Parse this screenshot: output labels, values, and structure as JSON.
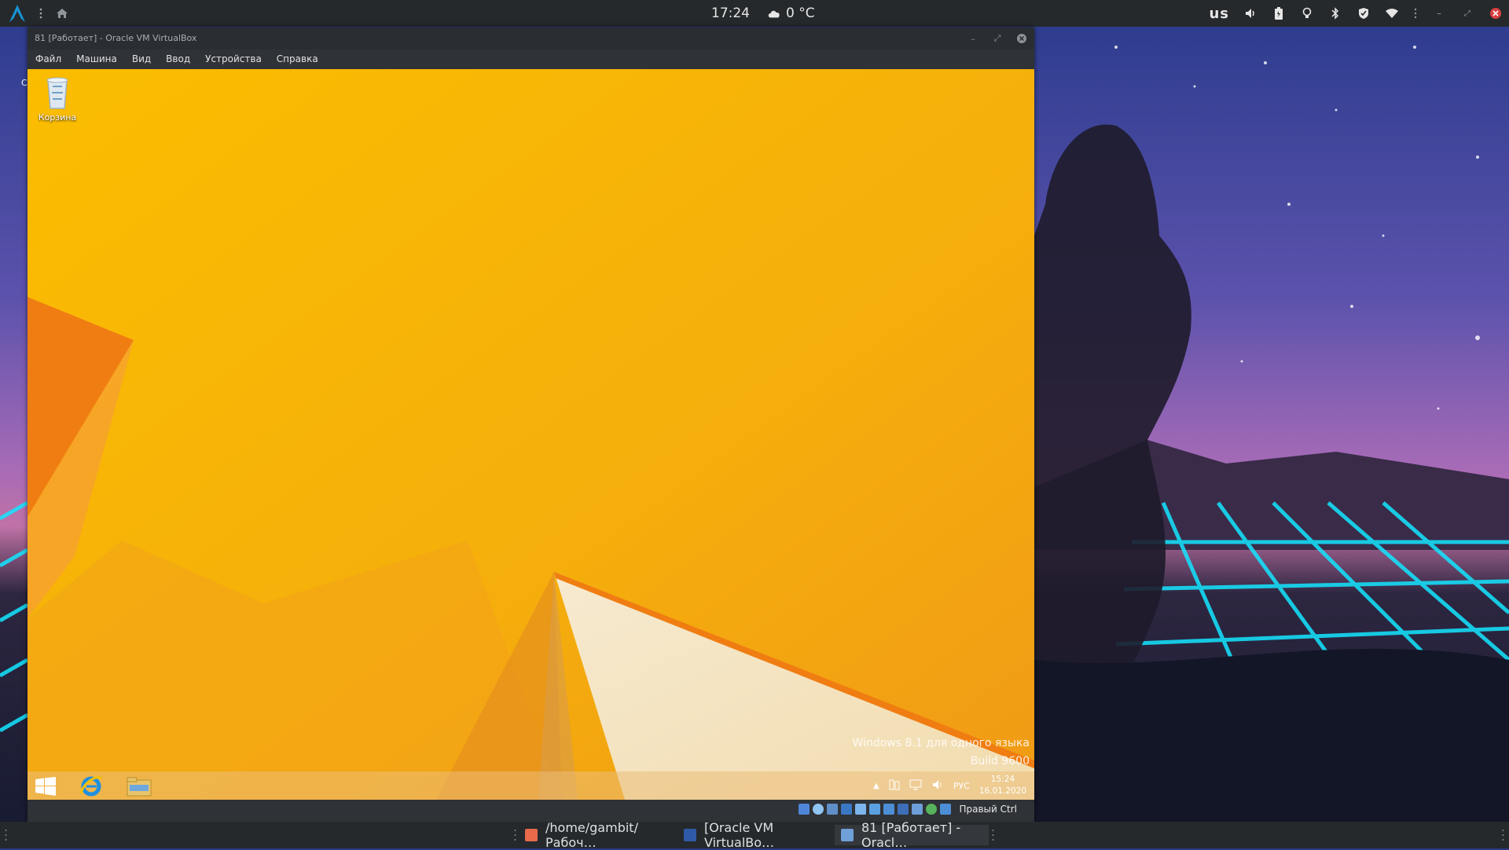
{
  "top_panel": {
    "launcher_icon": "arch-logo-icon",
    "menu_icon": "kebab-menu-icon",
    "home_icon": "home-icon",
    "clock": "17:24",
    "weather": {
      "icon": "cloud-icon",
      "temperature": "0 °C"
    },
    "keyboard_layout": "us",
    "tray_icons": [
      "volume-icon",
      "battery-icon",
      "lightbulb-icon",
      "bluetooth-icon",
      "shield-icon",
      "wifi-icon",
      "kebab-menu-icon",
      "minimize-icon",
      "restore-icon",
      "close-icon"
    ]
  },
  "vbox": {
    "title": "81 [Работает] - Oracle VM VirtualBox",
    "menu": [
      "Файл",
      "Машина",
      "Вид",
      "Ввод",
      "Устройства",
      "Справка"
    ],
    "host_key": "Правый Ctrl"
  },
  "guest": {
    "recycle_bin_label": "Корзина",
    "watermark_line1": "Windows 8.1 для одного языка",
    "watermark_line2": "Build 9600",
    "tray": {
      "lang": "РУС",
      "time": "15:24",
      "date": "16.01.2020"
    }
  },
  "host_left_edge_char": "С",
  "taskbar": {
    "tasks": [
      {
        "label": "/home/gambit/Рабоч…",
        "icon": "text-editor-icon",
        "color": "#e86a4a"
      },
      {
        "label": "[Oracle VM VirtualBo…",
        "icon": "virtualbox-icon",
        "color": "#2f5aa8"
      },
      {
        "label": "81 [Работает] - Oracl…",
        "icon": "virtualbox-vm-icon",
        "color": "#6fa0d8"
      }
    ]
  },
  "colors": {
    "panel": "#25292c",
    "windows_accent": "#f7b400",
    "grid_cyan": "#00e5ff"
  }
}
